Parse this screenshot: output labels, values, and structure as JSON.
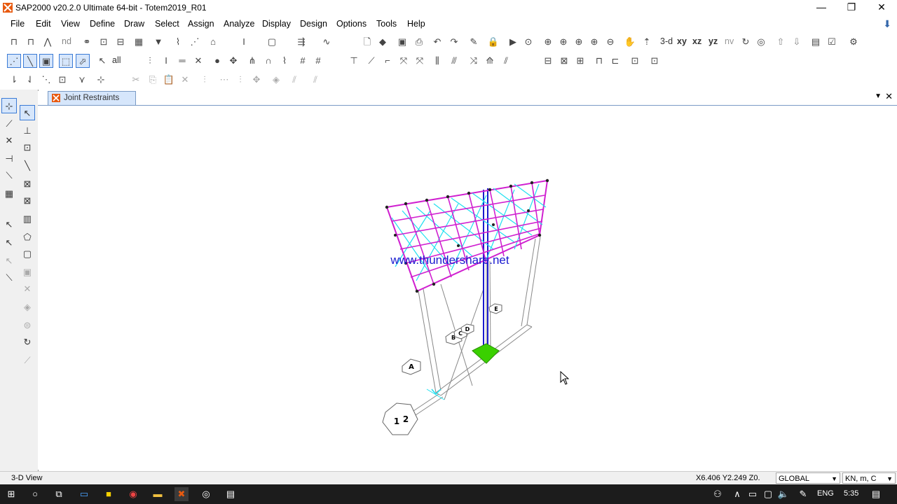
{
  "window": {
    "title": "SAP2000 v20.2.0 Ultimate 64-bit - Totem2019_R01",
    "minimize": "—",
    "restore": "❐",
    "close": "✕"
  },
  "menu": [
    "File",
    "Edit",
    "View",
    "Define",
    "Draw",
    "Select",
    "Assign",
    "Analyze",
    "Display",
    "Design",
    "Options",
    "Tools",
    "Help"
  ],
  "toolbar": {
    "view_3d": "3-d",
    "view_xy": "xy",
    "view_xz": "xz",
    "view_yz": "yz",
    "view_nv": "nv",
    "nd_label": "nd",
    "all_label": "all"
  },
  "tab": {
    "label": "Joint Restraints"
  },
  "viewport": {
    "watermark": "www.thundershare.net",
    "grid_bubbles": [
      "A",
      "B",
      "C",
      "D",
      "E",
      "1",
      "2"
    ]
  },
  "status": {
    "view_name": "3-D View",
    "coords": "X6.406  Y2.249  Z0.",
    "coord_system": "GLOBAL",
    "units": "KN, m, C"
  },
  "taskbar": {
    "language": "ENG",
    "time": "5:35"
  },
  "colors": {
    "frame_magenta": "#d020d0",
    "brace_cyan": "#20e0f0",
    "support_green": "#3ad000",
    "tab_bg": "#d6e6fb",
    "watermark_blue": "#1a1ad0"
  }
}
